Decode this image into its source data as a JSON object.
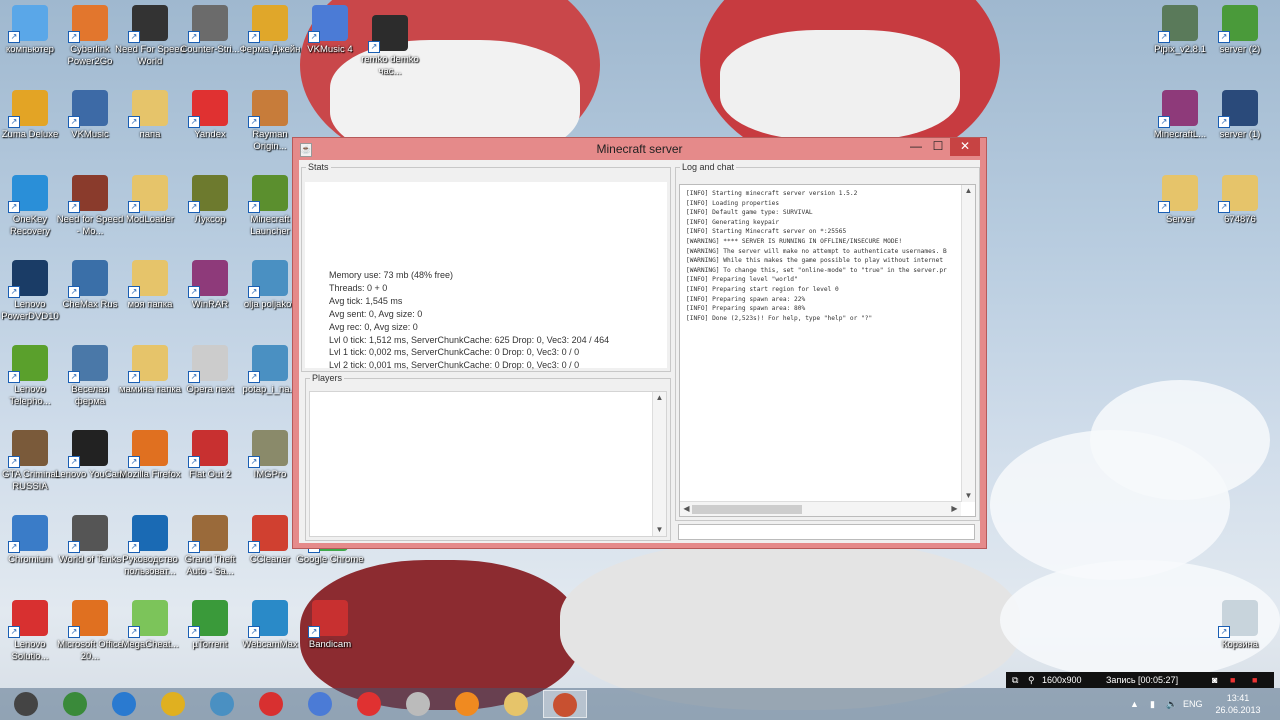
{
  "desktop": {
    "icons": [
      {
        "label": "компьютер",
        "color": "#5aa7e8"
      },
      {
        "label": "Cyberlink Power2Go",
        "color": "#e2762d"
      },
      {
        "label": "Need For Speed World",
        "color": "#333333"
      },
      {
        "label": "Counter-Stri...",
        "color": "#6b6b6b"
      },
      {
        "label": "Ферма Джейн",
        "color": "#e0a72a"
      },
      {
        "label": "VKMusic 4",
        "color": "#4b7bd6"
      },
      {
        "label": "remko demko час...",
        "color": "#2c2c2c"
      },
      {
        "label": "Zuma Deluxe",
        "color": "#e3a425"
      },
      {
        "label": "VKMusic",
        "color": "#3d6aa6"
      },
      {
        "label": "папа",
        "color": "#e6c46a"
      },
      {
        "label": "Yandex",
        "color": "#e03131"
      },
      {
        "label": "Rayman Origin...",
        "color": "#c77c3a"
      },
      {
        "label": "OneKey Recovery",
        "color": "#2a8fd8"
      },
      {
        "label": "Need for Speed - Mo...",
        "color": "#8a3b2c"
      },
      {
        "label": "ModLoader",
        "color": "#e6c46a"
      },
      {
        "label": "Луксор",
        "color": "#6d7a2e"
      },
      {
        "label": "Minecraft Launcher",
        "color": "#5b8f2e"
      },
      {
        "label": "Lenovo PowerDVD10",
        "color": "#1a3c66"
      },
      {
        "label": "CheMax Rus",
        "color": "#3a6fa8"
      },
      {
        "label": "моя папка",
        "color": "#e6c46a"
      },
      {
        "label": "WinRAR",
        "color": "#8e3a7a"
      },
      {
        "label": "olja poljakov",
        "color": "#4a90c2"
      },
      {
        "label": "Lenovo Telepho...",
        "color": "#5aa02c"
      },
      {
        "label": "Веселая ферма",
        "color": "#4a78a8"
      },
      {
        "label": "мамина папка",
        "color": "#e6c46a"
      },
      {
        "label": "Opera next",
        "color": "#cccccc"
      },
      {
        "label": "potap_i_na...",
        "color": "#4a90c2"
      },
      {
        "label": "GTA Criminal RUSSIA",
        "color": "#7a5a3a"
      },
      {
        "label": "Lenovo YouCam",
        "color": "#222222"
      },
      {
        "label": "Mozilla Firefox",
        "color": "#e07020"
      },
      {
        "label": "Flat Out 2",
        "color": "#c83030"
      },
      {
        "label": "IMGPro",
        "color": "#8a8a6a"
      },
      {
        "label": "Chromium",
        "color": "#3a7cc8"
      },
      {
        "label": "World of Tanks",
        "color": "#555555"
      },
      {
        "label": "Руководство пользоват...",
        "color": "#1a6ab4"
      },
      {
        "label": "Grand Theft Auto - Sa...",
        "color": "#9a6a3a"
      },
      {
        "label": "CCleaner",
        "color": "#d04030"
      },
      {
        "label": "Google Chrome",
        "color": "#3fa84a"
      },
      {
        "label": "Lenovo Solutio...",
        "color": "#d83030"
      },
      {
        "label": "Microsoft Office 20...",
        "color": "#e07020"
      },
      {
        "label": "MegaCheat...",
        "color": "#7cc45a"
      },
      {
        "label": "µTorrent",
        "color": "#3a9a3a"
      },
      {
        "label": "WebcamMax",
        "color": "#2a8ac8"
      },
      {
        "label": "Bandicam",
        "color": "#c83030"
      },
      {
        "label": "Pipix_v2.8.1",
        "color": "#5a7a5a"
      },
      {
        "label": "server (2)",
        "color": "#4a9a3a"
      },
      {
        "label": "MinecraftL...",
        "color": "#8e3a7a"
      },
      {
        "label": "server (1)",
        "color": "#2a4a7a"
      },
      {
        "label": "Server",
        "color": "#e6c46a"
      },
      {
        "label": "674876",
        "color": "#e6c46a"
      },
      {
        "label": "Корзина",
        "color": "#c8d4dc"
      }
    ]
  },
  "window": {
    "title": "Minecraft server",
    "min_glyph": "—",
    "max_glyph": "☐",
    "close_glyph": "✕",
    "stats_legend": "Stats",
    "stats": [
      "Memory use: 73 mb (48% free)",
      "Threads: 0 + 0",
      "Avg tick: 1,545 ms",
      "Avg sent: 0, Avg size: 0",
      "Avg rec: 0, Avg size: 0",
      "Lvl 0 tick: 1,512 ms, ServerChunkCache: 625 Drop: 0, Vec3: 204 / 464",
      "Lvl 1 tick: 0,002 ms, ServerChunkCache: 0 Drop: 0, Vec3: 0 / 0",
      "Lvl 2 tick: 0,001 ms, ServerChunkCache: 0 Drop: 0, Vec3: 0 / 0"
    ],
    "players_legend": "Players",
    "log_legend": "Log and chat",
    "log": [
      "[INFO] Starting minecraft server version 1.5.2",
      "[INFO] Loading properties",
      "[INFO] Default game type: SURVIVAL",
      "[INFO] Generating keypair",
      "[INFO] Starting Minecraft server on *:25565",
      "[WARNING] **** SERVER IS RUNNING IN OFFLINE/INSECURE MODE!",
      "[WARNING] The server will make no attempt to authenticate usernames. B",
      "[WARNING] While this makes the game possible to play without internet",
      "[WARNING] To change this, set \"online-mode\" to \"true\" in the server.pr",
      "[INFO] Preparing level \"world\"",
      "[INFO] Preparing start region for level 0",
      "[INFO] Preparing spawn area: 22%",
      "[INFO] Preparing spawn area: 80%",
      "[INFO] Done (2,523s)! For help, type \"help\" or \"?\""
    ]
  },
  "taskbar": {
    "apps": [
      {
        "name": "unknown-app",
        "color": "#444444"
      },
      {
        "name": "game-app",
        "color": "#3a8a3a"
      },
      {
        "name": "internet-explorer",
        "color": "#2a7ad0"
      },
      {
        "name": "chrome",
        "color": "#e0b020"
      },
      {
        "name": "olja-app",
        "color": "#4a90c2"
      },
      {
        "name": "yandex-browser",
        "color": "#d83030"
      },
      {
        "name": "vkmusic",
        "color": "#4b7bd6"
      },
      {
        "name": "yandex",
        "color": "#e03131"
      },
      {
        "name": "opera",
        "color": "#bbbbbb"
      },
      {
        "name": "odnoklassniki",
        "color": "#f08a20"
      },
      {
        "name": "explorer",
        "color": "#e6c46a"
      },
      {
        "name": "java",
        "color": "#c85030"
      }
    ],
    "lang": "ENG",
    "time": "13:41",
    "date": "26.06.2013",
    "rec_resolution": "1600x900",
    "rec_label": "Запись [00:05:27]"
  }
}
